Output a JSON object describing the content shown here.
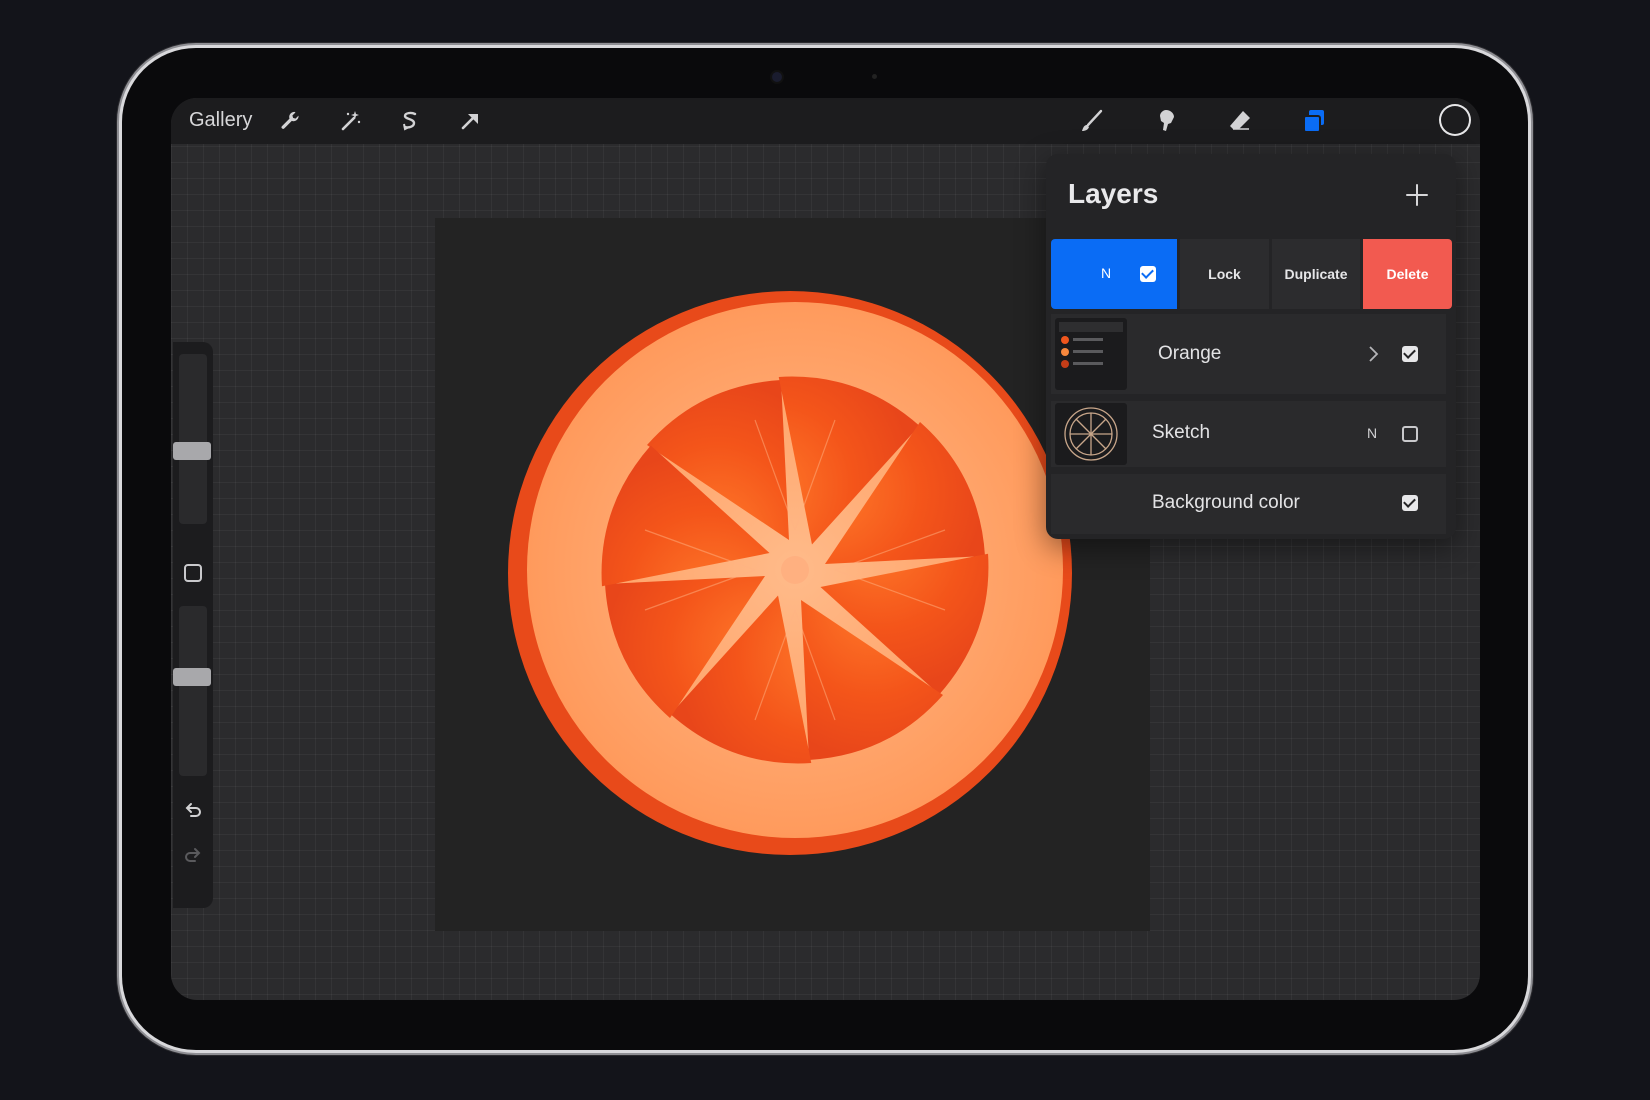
{
  "toolbar": {
    "gallery_label": "Gallery",
    "left_tools": [
      "wrench-icon",
      "magic-wand-icon",
      "selection-icon",
      "transform-arrow-icon"
    ],
    "right_tools": [
      "brush-icon",
      "smudge-icon",
      "eraser-icon",
      "layers-icon"
    ],
    "active_tool": "layers-icon",
    "accent_color": "#0a6cf5"
  },
  "layers_panel": {
    "title": "Layers",
    "actions": {
      "mode": "N",
      "lock": "Lock",
      "duplicate": "Duplicate",
      "delete": "Delete",
      "delete_color": "#f25a50"
    },
    "rows": [
      {
        "name": "Orange",
        "type": "group",
        "visible": true
      },
      {
        "name": "Sketch",
        "mode": "N",
        "visible": false
      },
      {
        "name": "Background color",
        "visible": true
      }
    ]
  },
  "canvas": {
    "background": "#232323",
    "subject": "orange-slice-illustration"
  }
}
